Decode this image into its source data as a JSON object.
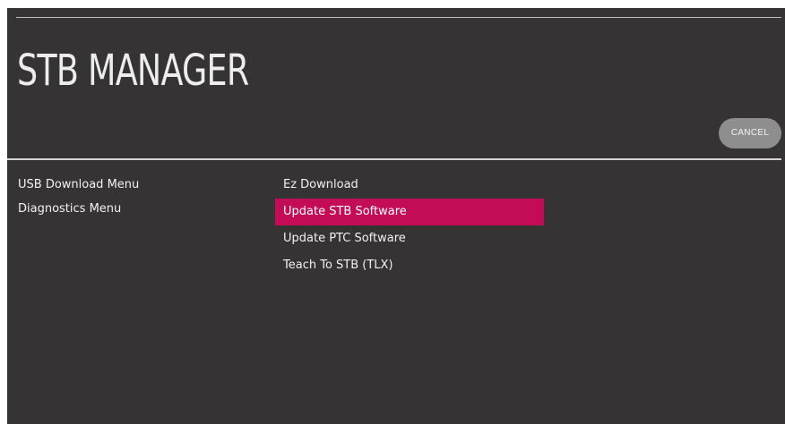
{
  "header": {
    "title": "STB MANAGER",
    "cancel_label": "CANCEL"
  },
  "left_menu": {
    "items": [
      {
        "label": "USB Download Menu"
      },
      {
        "label": "Diagnostics Menu"
      }
    ]
  },
  "right_menu": {
    "selected_index": 1,
    "items": [
      {
        "label": "Ez Download"
      },
      {
        "label": "Update STB Software"
      },
      {
        "label": "Update PTC Software"
      },
      {
        "label": "Teach To STB (TLX)"
      }
    ]
  },
  "colors": {
    "background": "#353334",
    "highlight": "#c30c55",
    "cancel_button": "#8e8e8e",
    "text": "#f2f2f2"
  }
}
